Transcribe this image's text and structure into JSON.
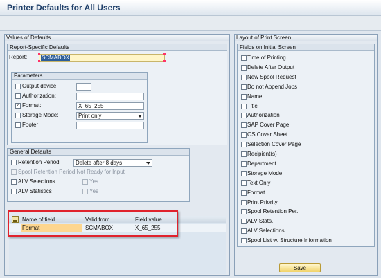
{
  "window": {
    "title": "Printer Defaults for All Users"
  },
  "values_panel": {
    "title": "Values of Defaults",
    "report_specific": {
      "title": "Report-Specific Defaults",
      "report_label": "Report:",
      "report_value": "SCMABOX"
    },
    "parameters": {
      "title": "Parameters",
      "output_device": {
        "label": "Output device:",
        "checked": false,
        "value": ""
      },
      "authorization": {
        "label": "Authorization:",
        "checked": false,
        "value": ""
      },
      "format": {
        "label": "Format:",
        "checked": true,
        "value": "X_65_255"
      },
      "storage_mode": {
        "label": "Storage Mode:",
        "checked": false,
        "value": "Print only"
      },
      "footer": {
        "label": "Footer",
        "checked": false,
        "value": ""
      }
    },
    "general": {
      "title": "General Defaults",
      "retention_period": {
        "label": "Retention Period",
        "value": "Delete after 8 days"
      },
      "spool_not_ready": {
        "label": "Spool Retention Period Not Ready for Input"
      },
      "alv_selections": {
        "label": "ALV Selections",
        "yes_label": "Yes"
      },
      "alv_statistics": {
        "label": "ALV Statistics",
        "yes_label": "Yes"
      }
    },
    "table": {
      "columns": [
        "Name of field",
        "Valid from",
        "Field value"
      ],
      "rows": [
        {
          "name": "Format",
          "valid_from": "SCMABOX",
          "value": "X_65_255"
        }
      ]
    }
  },
  "layout_panel": {
    "title": "Layout of Print Screen",
    "group_title": "Fields on Initial Screen",
    "items": [
      "Time of Printing",
      "Delete After Output",
      "New Spool Request",
      "Do not Append Jobs",
      "Name",
      "Title",
      "Authorization",
      "SAP Cover Page",
      "OS Cover Sheet",
      "Selection Cover Page",
      "Recipient(s)",
      "Department",
      "Storage Mode",
      "Text Only",
      "Format",
      "Print Priority",
      "Spool Retention Per.",
      "ALV Stats.",
      "ALV Selections",
      "Spool List w. Structure Information"
    ],
    "save_label": "Save"
  },
  "colors": {
    "highlight": "#e0222c",
    "required_field": "#fff6c8",
    "selected_cell": "#fdd68f"
  }
}
